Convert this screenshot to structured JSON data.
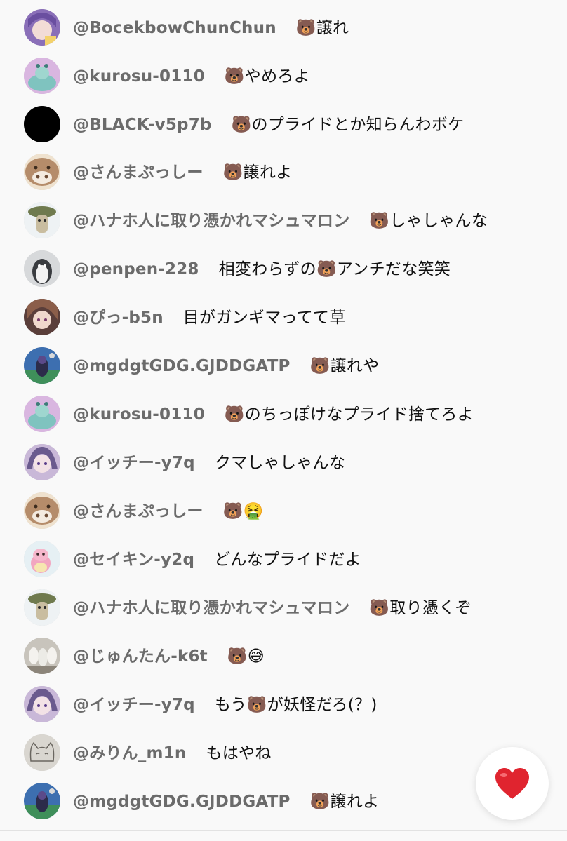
{
  "chat": {
    "messages": [
      {
        "username": "@BocekbowChunChun",
        "message": "🐻譲れ",
        "avatar": "anime-girl-purple"
      },
      {
        "username": "@kurosu-0110",
        "message": "🐻やめろよ",
        "avatar": "teal-creature"
      },
      {
        "username": "@BLACK-v5p7b",
        "message": "🐻のプライドとか知らんわボケ",
        "avatar": "solid-black"
      },
      {
        "username": "@さんまぷっしー",
        "message": "🐻譲れよ",
        "avatar": "boar-face"
      },
      {
        "username": "@ハナホ人に取り憑かれマシュマロン",
        "message": "🐻しゃしゃんな",
        "avatar": "mushroom-creature"
      },
      {
        "username": "@penpen-228",
        "message": "相変わらずの🐻アンチだな笑笑",
        "avatar": "penguin"
      },
      {
        "username": "@ぴっ-b5n",
        "message": "目がガンギマってて草",
        "avatar": "anime-girl-brown"
      },
      {
        "username": "@mgdgtGDG.GJDDGATP",
        "message": "🐻譲れや",
        "avatar": "game-character"
      },
      {
        "username": "@kurosu-0110",
        "message": "🐻のちっぽけなプライド捨てろよ",
        "avatar": "teal-creature"
      },
      {
        "username": "@イッチー-y7q",
        "message": "クマしゃしゃんな",
        "avatar": "anime-girl-lavender"
      },
      {
        "username": "@さんまぷっしー",
        "message": "🐻🤮",
        "avatar": "boar-face"
      },
      {
        "username": "@セイキン-y2q",
        "message": "どんなプライドだよ",
        "avatar": "pink-pokemon"
      },
      {
        "username": "@ハナホ人に取り憑かれマシュマロン",
        "message": "🐻取り憑くぞ",
        "avatar": "mushroom-creature"
      },
      {
        "username": "@じゅんたん-k6t",
        "message": "🐻😅",
        "avatar": "white-figures"
      },
      {
        "username": "@イッチー-y7q",
        "message": "もう🐻が妖怪だろ(？)",
        "avatar": "anime-girl-lavender"
      },
      {
        "username": "@みりん_m1n",
        "message": "もはやね",
        "avatar": "cat-doodle"
      },
      {
        "username": "@mgdgtGDG.GJDDGATP",
        "message": "🐻譲れよ",
        "avatar": "game-character"
      }
    ]
  },
  "like_button": {
    "icon": "heart-icon",
    "color": "#e0242f"
  },
  "colors": {
    "background": "#f9f9f9",
    "username": "#6b6b6b",
    "message": "#111111"
  }
}
